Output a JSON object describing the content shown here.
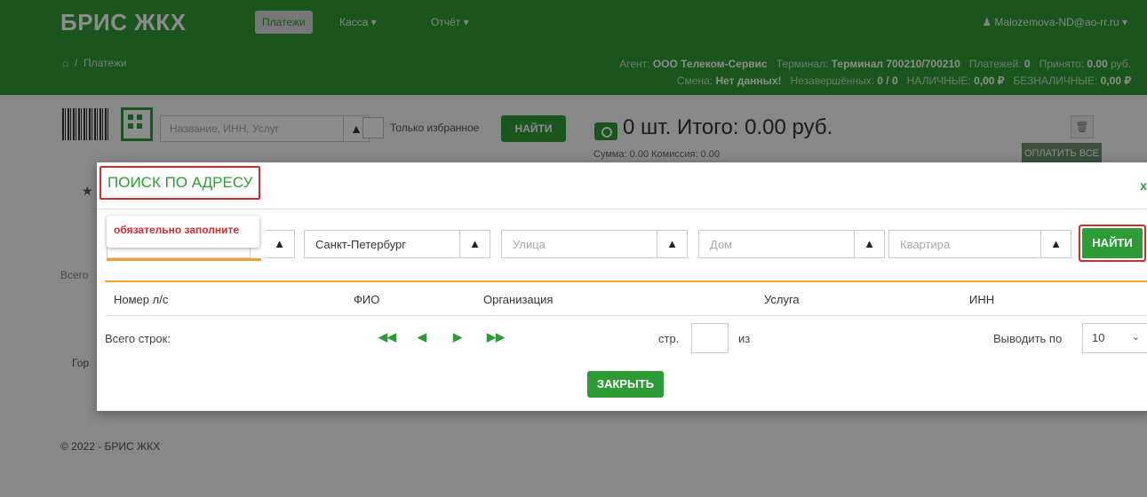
{
  "header": {
    "brand": "БРИС ЖКХ",
    "nav": {
      "payments": "Платежи",
      "kassa": "Касса ▾",
      "report": "Отчёт ▾"
    },
    "user": "Malozemova-ND@ao-rr.ru ▾",
    "breadcrumb": {
      "home_icon": "home-icon",
      "separator": "/",
      "current": "Платежи"
    },
    "info1": {
      "agent_label": "Агент:",
      "agent": "ООО Телеком-Сервис",
      "terminal_label": "Терминал:",
      "terminal": "Терминал 700210/700210",
      "payments_label": "Платежей:",
      "payments": "0",
      "accepted_label": "Принято:",
      "accepted": "0.00",
      "accepted_unit": "руб."
    },
    "info2": {
      "shift_label": "Смена:",
      "shift": "Нет данных!",
      "unfinished_label": "Незавершённых:",
      "unfinished": "0 / 0",
      "cash_label": "НАЛИЧНЫЕ:",
      "cash": "0,00 ₽",
      "noncash_label": "БЕЗНАЛИЧНЫЕ:",
      "noncash": "0,00 ₽"
    }
  },
  "toolbar": {
    "search_placeholder": "Название, ИНН, Услуг",
    "only_favorites": "Только избранное",
    "find": "НАЙТИ",
    "total": "0 шт.  Итого: 0.00 руб.",
    "sum_line": "Сумма: 0.00   Комиссия: 0.00",
    "pay_all": "ОПЛАТИТЬ ВСЕ"
  },
  "background": {
    "total_rows": "Всего",
    "city": "Гор",
    "footer": "© 2022 - БРИС ЖКХ"
  },
  "modal": {
    "title": "ПОИСК ПО АДРЕСУ",
    "close_x": "x",
    "tooltip": "обязательно заполните",
    "city_value": "Санкт-Петербург",
    "street_placeholder": "Улица",
    "house_placeholder": "Дом",
    "apartment_placeholder": "Квартира",
    "find": "НАЙТИ",
    "columns": [
      "Номер л/с",
      "ФИО",
      "Организация",
      "Услуга",
      "ИНН"
    ],
    "total_rows_label": "Всего строк:",
    "page_label": "стр.",
    "of_label": "из",
    "per_page_label": "Выводить по",
    "per_page_value": "10",
    "close_button": "ЗАКРЫТЬ"
  },
  "colors": {
    "accent": "#2e9c36",
    "highlight": "#d62b2b",
    "underline": "#f0a030"
  }
}
